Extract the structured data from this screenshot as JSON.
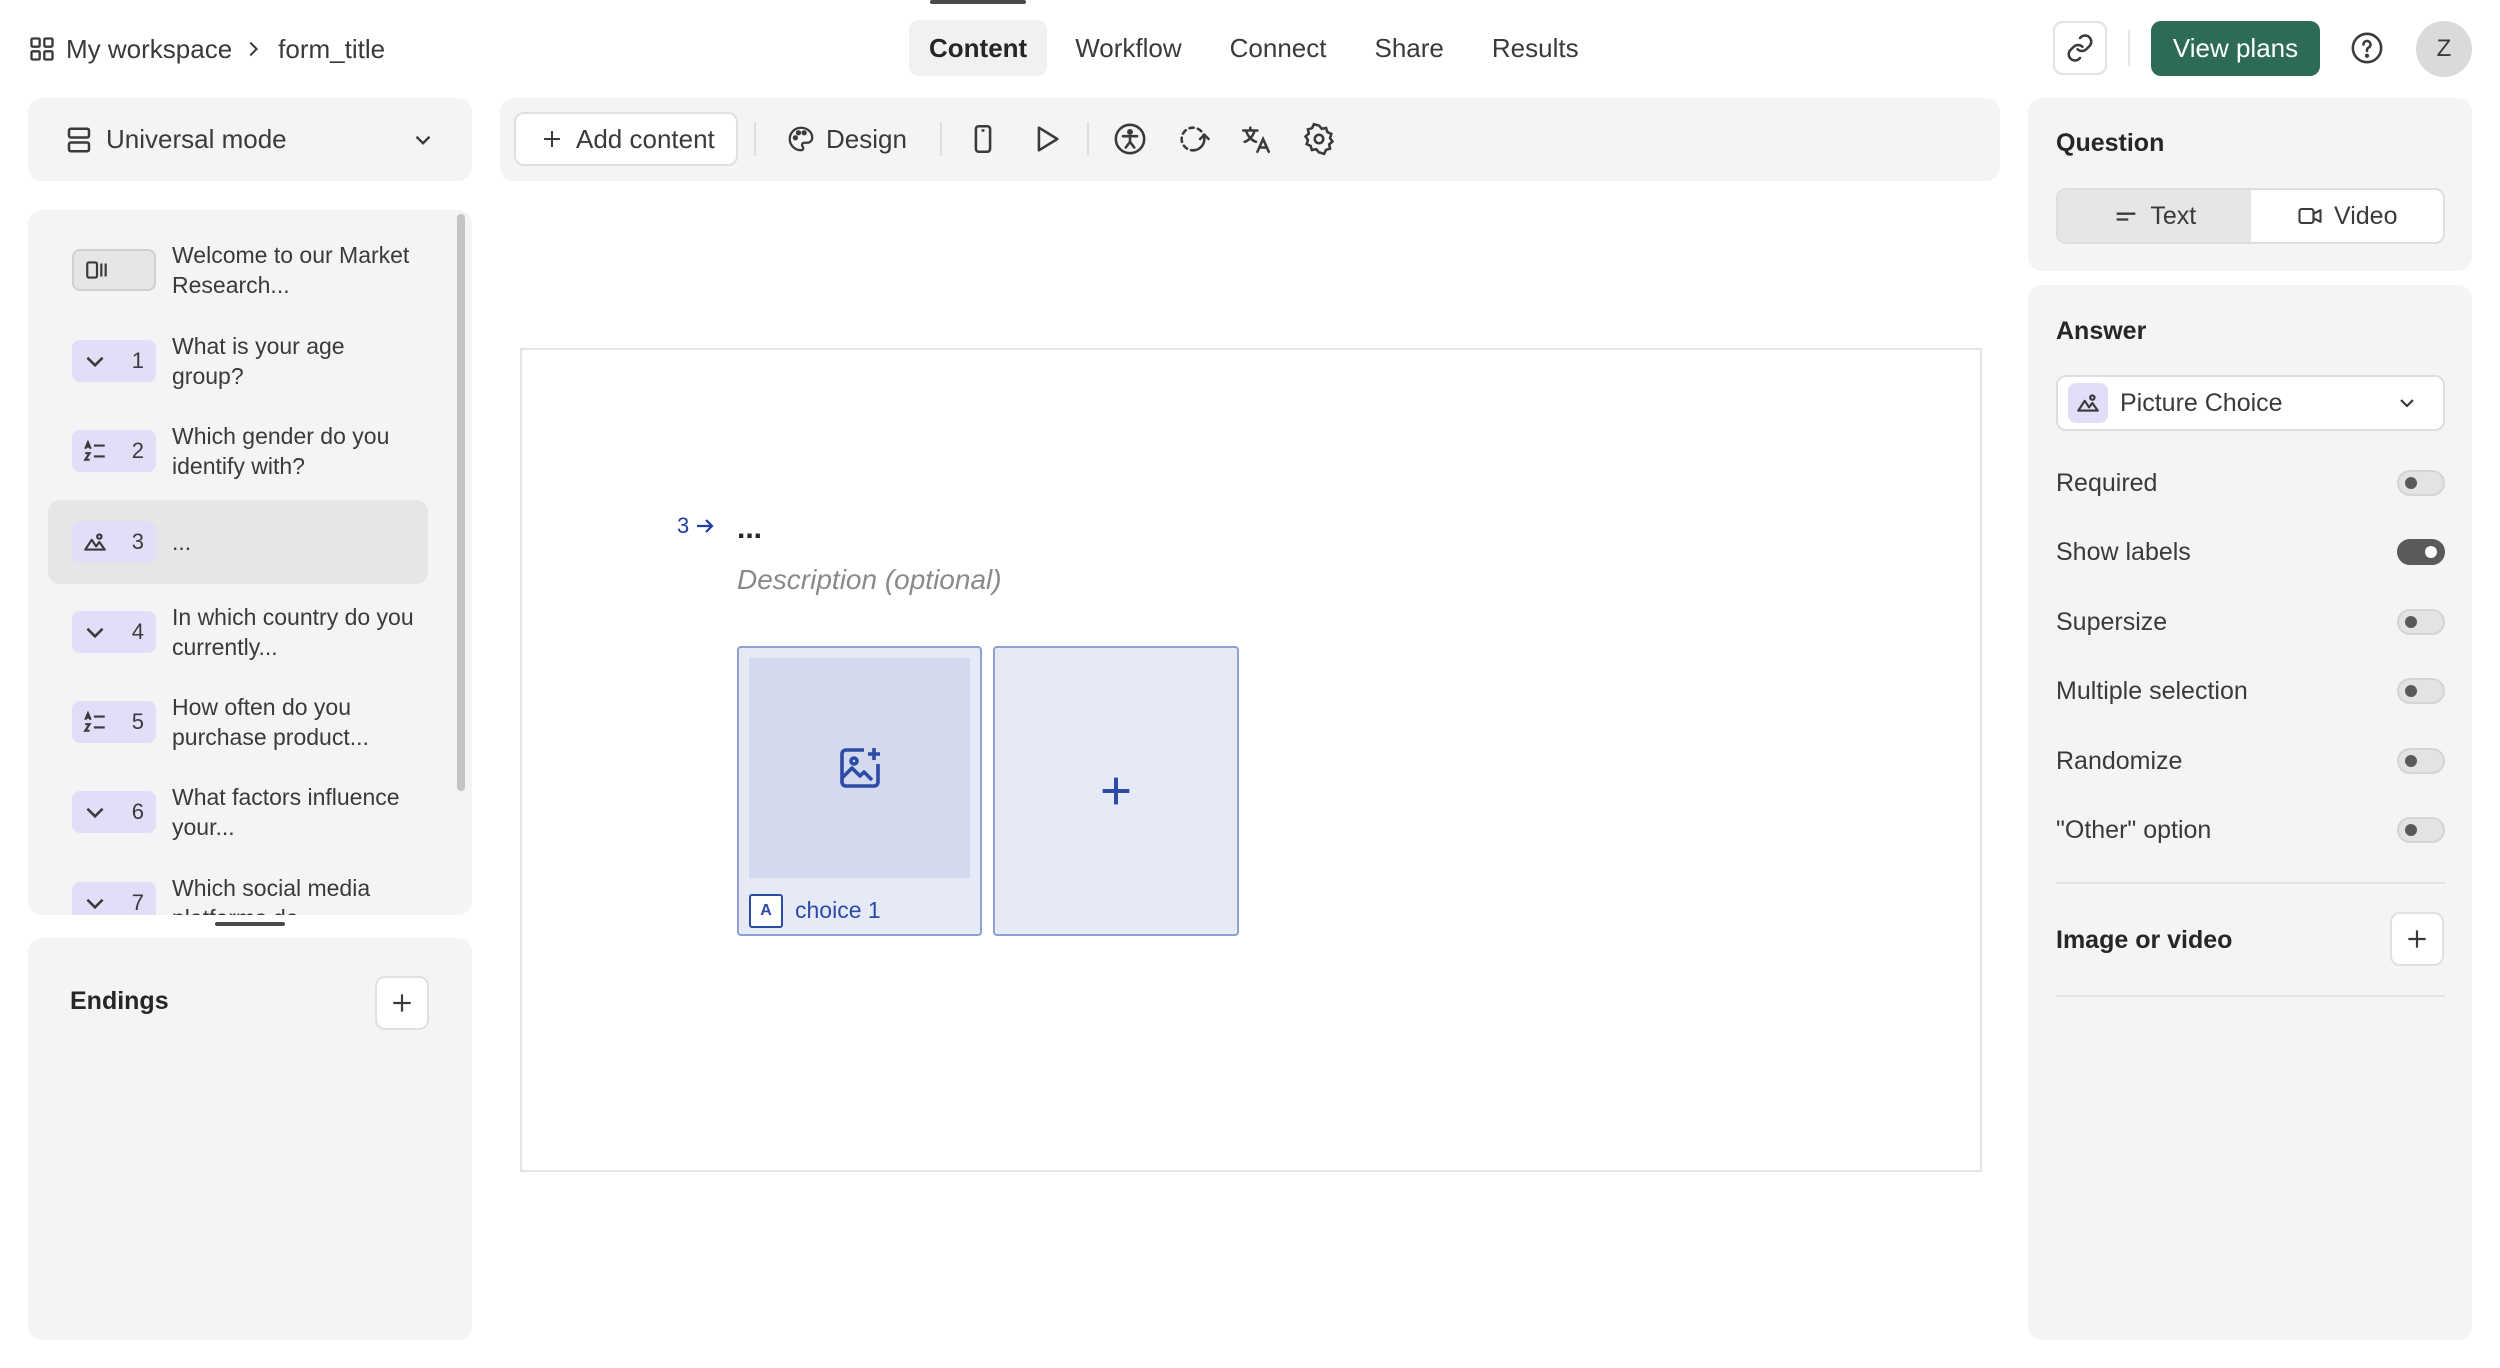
{
  "header": {
    "workspace": "My workspace",
    "form_title": "form_title",
    "tabs": [
      {
        "label": "Content",
        "active": true
      },
      {
        "label": "Workflow",
        "active": false
      },
      {
        "label": "Connect",
        "active": false
      },
      {
        "label": "Share",
        "active": false
      },
      {
        "label": "Results",
        "active": false
      }
    ],
    "view_plans_label": "View plans",
    "avatar_initial": "Z"
  },
  "sidebar": {
    "mode_label": "Universal mode",
    "questions": [
      {
        "type_icon": "welcome-screen-icon",
        "number": "",
        "title": "Welcome to our Market Research...",
        "active": false
      },
      {
        "type_icon": "dropdown-icon",
        "number": "1",
        "title": "What is your age group?",
        "active": false
      },
      {
        "type_icon": "ranking-icon",
        "number": "2",
        "title": "Which gender do you identify with?",
        "active": false
      },
      {
        "type_icon": "picture-choice-icon",
        "number": "3",
        "title": "...",
        "active": true
      },
      {
        "type_icon": "dropdown-icon",
        "number": "4",
        "title": "In which country do you currently...",
        "active": false
      },
      {
        "type_icon": "ranking-icon",
        "number": "5",
        "title": "How often do you purchase product...",
        "active": false
      },
      {
        "type_icon": "dropdown-icon",
        "number": "6",
        "title": "What factors influence your...",
        "active": false
      },
      {
        "type_icon": "dropdown-icon",
        "number": "7",
        "title": "Which social media platforms do...",
        "active": false
      }
    ],
    "endings_label": "Endings"
  },
  "toolbar": {
    "add_content_label": "Add content",
    "design_label": "Design",
    "icons": [
      "mobile-preview-icon",
      "play-preview-icon",
      "accessibility-icon",
      "logic-icon",
      "translate-icon",
      "settings-icon"
    ]
  },
  "canvas": {
    "question_number": "3",
    "question_title": "...",
    "description_placeholder": "Description (optional)",
    "choices": [
      {
        "key": "A",
        "label": "choice 1"
      }
    ]
  },
  "right_panel": {
    "question_label": "Question",
    "question_types": [
      {
        "label": "Text",
        "active": true
      },
      {
        "label": "Video",
        "active": false
      }
    ],
    "answer_label": "Answer",
    "answer_type": "Picture Choice",
    "options": [
      {
        "label": "Required",
        "on": false
      },
      {
        "label": "Show labels",
        "on": true
      },
      {
        "label": "Supersize",
        "on": false
      },
      {
        "label": "Multiple selection",
        "on": false
      },
      {
        "label": "Randomize",
        "on": false
      },
      {
        "label": "\"Other\" option",
        "on": false
      }
    ],
    "image_or_video_label": "Image or video"
  },
  "colors": {
    "brand_green": "#2e6b57",
    "accent_blue": "#2c4aa6",
    "badge_purple": "#e3ddf8",
    "panel_gray": "#f4f4f4"
  }
}
